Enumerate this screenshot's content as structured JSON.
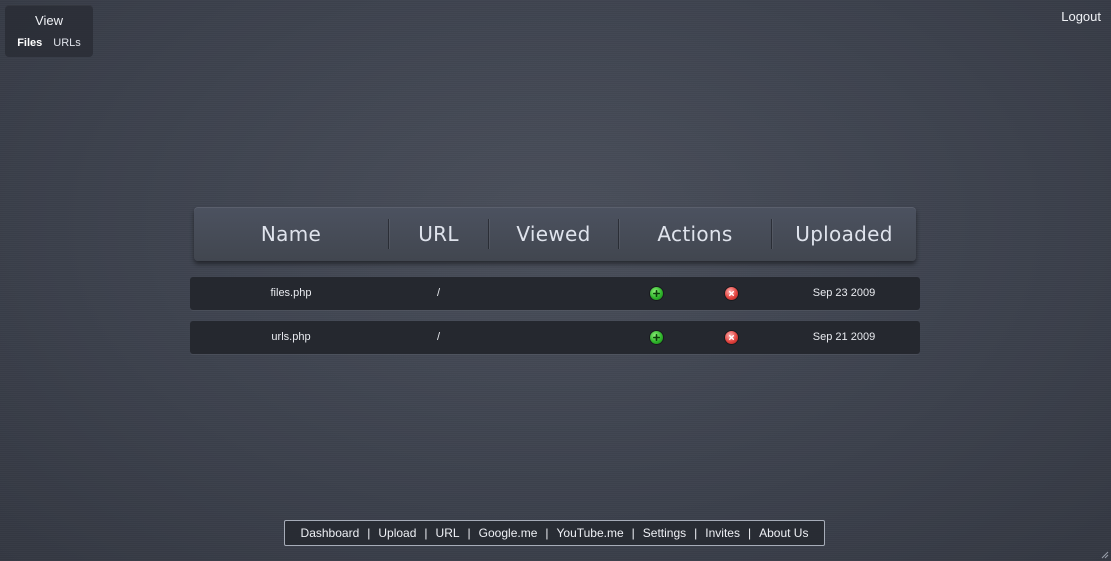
{
  "view_panel": {
    "title": "View",
    "links": [
      "Files",
      "URLs"
    ]
  },
  "header": {
    "logout_label": "Logout"
  },
  "table": {
    "columns": [
      "Name",
      "URL",
      "Viewed",
      "Actions",
      "Uploaded"
    ],
    "rows": [
      {
        "name": "files.php",
        "url": "/",
        "viewed": "",
        "uploaded": "Sep 23 2009"
      },
      {
        "name": "urls.php",
        "url": "/",
        "viewed": "",
        "uploaded": "Sep 21 2009"
      }
    ],
    "action_icons": [
      "add-icon",
      "delete-icon"
    ]
  },
  "footer_nav": {
    "links": [
      "Dashboard",
      "Upload",
      "URL",
      "Google.me",
      "YouTube.me",
      "Settings",
      "Invites",
      "About Us"
    ],
    "separator": "|"
  },
  "colors": {
    "background": "#3f4450",
    "row_background": "#25282f",
    "add_icon": "#2fb52b",
    "delete_icon": "#e2443f"
  }
}
